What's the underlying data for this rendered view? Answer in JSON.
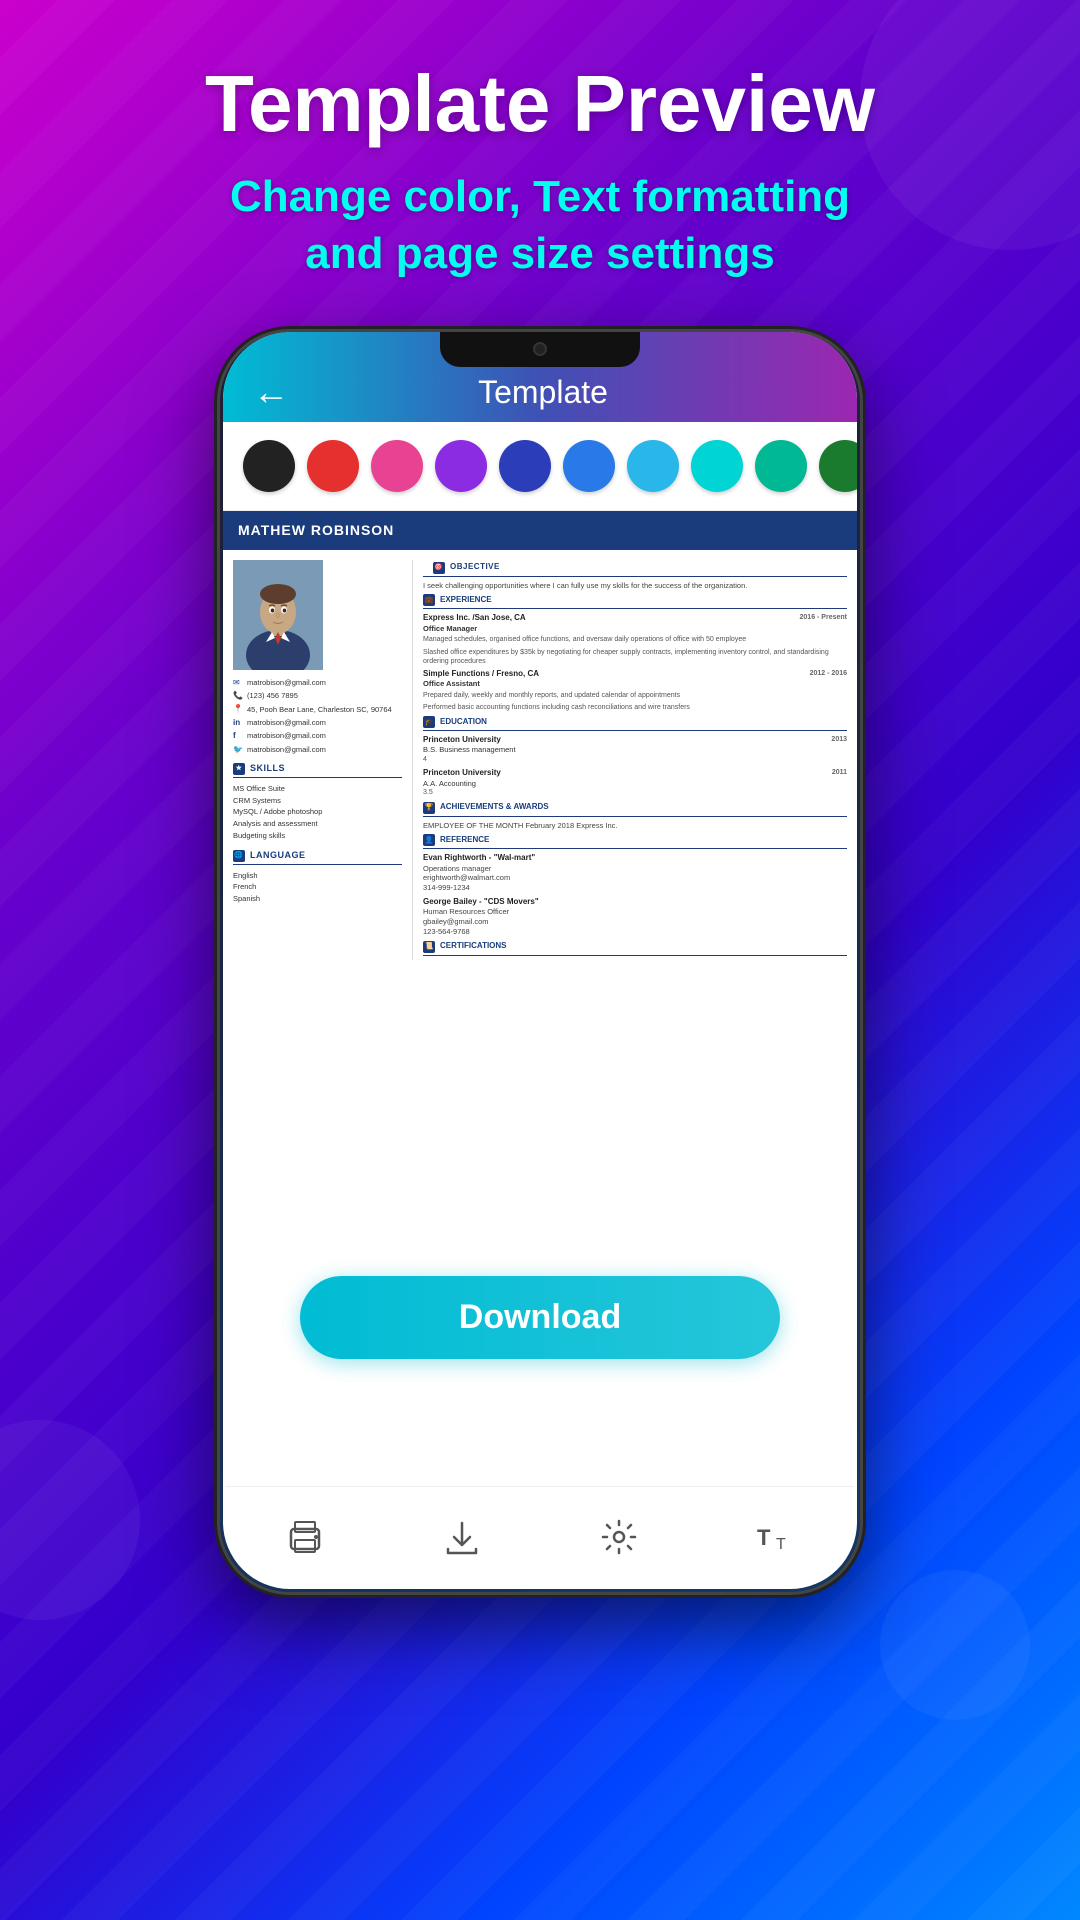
{
  "header": {
    "title": "Template Preview",
    "subtitle_line1": "Change color, Text formatting",
    "subtitle_line2": "and page size settings"
  },
  "phone": {
    "app_title": "Template",
    "back_label": "←"
  },
  "color_swatches": [
    {
      "name": "black",
      "color": "#222222"
    },
    {
      "name": "red",
      "color": "#e63030"
    },
    {
      "name": "pink",
      "color": "#e84393"
    },
    {
      "name": "purple",
      "color": "#8b2be2"
    },
    {
      "name": "dark-blue",
      "color": "#2b3db8"
    },
    {
      "name": "blue",
      "color": "#2979e8"
    },
    {
      "name": "light-blue",
      "color": "#29b6e8"
    },
    {
      "name": "cyan",
      "color": "#00d4d4"
    },
    {
      "name": "teal",
      "color": "#00b894"
    },
    {
      "name": "green",
      "color": "#1a7a2e"
    }
  ],
  "resume": {
    "name": "MATHEW ROBINSON",
    "contact": {
      "email": "matrobison@gmail.com",
      "phone": "(123) 456 7895",
      "address": "45, Pooh Bear Lane, Charleston SC, 90764",
      "linkedin": "matrobison@gmail.com",
      "facebook": "matrobison@gmail.com",
      "twitter": "matrobison@gmail.com"
    },
    "skills": {
      "heading": "SKILLS",
      "items": [
        "MS Office Suite",
        "CRM Systems",
        "MySQL / Adobe photoshop",
        "Analysis and assessment",
        "Budgeting skills"
      ]
    },
    "language": {
      "heading": "LANGUAGE",
      "items": [
        "English",
        "French",
        "Spanish"
      ]
    },
    "objective": {
      "heading": "OBJECTIVE",
      "text": "I seek challenging opportunities where I can fully use my skills for the success of the organization."
    },
    "experience": {
      "heading": "EXPERIENCE",
      "items": [
        {
          "company": "Express Inc. /San Jose, CA",
          "dates": "2016 - Present",
          "title": "Office Manager",
          "desc1": "Managed schedules, organised office functions, and oversaw daily operations of office with 50 employee",
          "desc2": "Slashed office expenditures by $35k by negotiating for cheaper supply contracts, implementing inventory control, and standardising ordering procedures"
        },
        {
          "company": "Simple Functions / Fresno, CA",
          "dates": "2012 - 2016",
          "title": "Office Assistant",
          "desc1": "Prepared daily, weekly and monthly reports, and updated calendar of appointments",
          "desc2": "Performed basic accounting functions including cash reconciliations and wire transfers"
        }
      ]
    },
    "education": {
      "heading": "EDUCATION",
      "items": [
        {
          "school": "Princeton University",
          "year": "2013",
          "degree": "B.S. Business management",
          "gpa": "4"
        },
        {
          "school": "Princeton University",
          "year": "2011",
          "degree": "A.A. Accounting",
          "gpa": "3.5"
        }
      ]
    },
    "achievements": {
      "heading": "ACHIEVEMENTS & AWARDS",
      "text": "EMPLOYEE OF THE MONTH February 2018 Express Inc."
    },
    "reference": {
      "heading": "REFERENCE",
      "items": [
        {
          "name": "Evan Rightworth - \"Wal-mart\"",
          "title": "Operations manager",
          "email": "erightworth@walmart.com",
          "phone": "314-999-1234"
        },
        {
          "name": "George Bailey - \"CDS Movers\"",
          "title": "Human Resources Officer",
          "email": "gbailey@gmail.com",
          "phone": "123-564-9768"
        }
      ]
    },
    "certifications": {
      "heading": "CERTIFICATIONS"
    }
  },
  "download_button": {
    "label": "Download"
  },
  "bottom_nav": {
    "icons": [
      {
        "name": "print-icon",
        "label": "Print"
      },
      {
        "name": "download-icon",
        "label": "Download"
      },
      {
        "name": "settings-icon",
        "label": "Settings"
      },
      {
        "name": "text-size-icon",
        "label": "Text Size"
      }
    ]
  }
}
